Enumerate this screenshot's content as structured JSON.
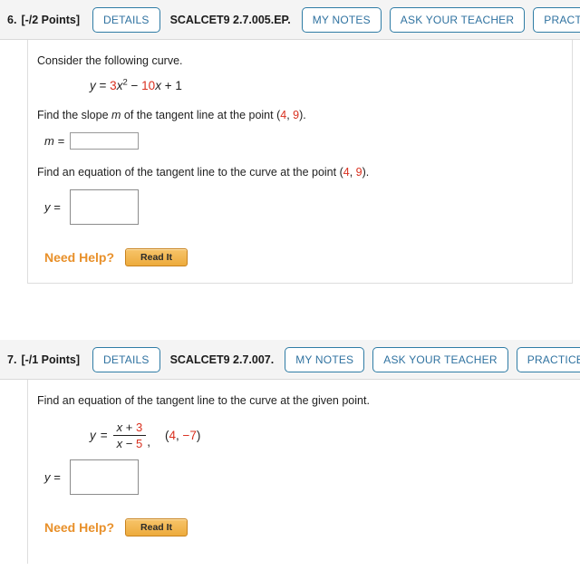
{
  "problems": [
    {
      "number": "6.",
      "points": "[-/2 Points]",
      "details_label": "DETAILS",
      "code": "SCALCET9 2.7.005.EP.",
      "my_notes_label": "MY NOTES",
      "ask_teacher_label": "ASK YOUR TEACHER",
      "practice_label": "PRACTICE",
      "prompt1": "Consider the following curve.",
      "equation": {
        "lhs": "y",
        "eq": "=",
        "coef1": "3",
        "var1": "x",
        "exp1": "2",
        "minus": "−",
        "coef2": "10",
        "var2": "x",
        "plus": "+",
        "const": "1"
      },
      "prompt2_a": "Find the slope ",
      "prompt2_m": "m",
      "prompt2_b": " of the tangent line at the point (",
      "prompt2_x": "4",
      "prompt2_sep": ", ",
      "prompt2_y": "9",
      "prompt2_c": ").",
      "answer1_label": "m =",
      "answer1_value": "",
      "prompt3_a": "Find an equation of the tangent line to the curve at the point (",
      "prompt3_x": "4",
      "prompt3_sep": ", ",
      "prompt3_y": "9",
      "prompt3_c": ").",
      "answer2_label": "y =",
      "answer2_value": "",
      "help_label": "Need Help?",
      "read_it_label": "Read It"
    },
    {
      "number": "7.",
      "points": "[-/1 Points]",
      "details_label": "DETAILS",
      "code": "SCALCET9 2.7.007.",
      "my_notes_label": "MY NOTES",
      "ask_teacher_label": "ASK YOUR TEACHER",
      "practice_label": "PRACTICE",
      "prompt1": "Find an equation of the tangent line to the curve at the given point.",
      "equation": {
        "lhs": "y",
        "eq": "=",
        "num_var": "x",
        "num_op": "+",
        "num_const": "3",
        "den_var": "x",
        "den_op": "−",
        "den_const": "5",
        "comma": ",",
        "point_open": "(",
        "point_x": "4",
        "point_sep": ", ",
        "point_y": "−7",
        "point_close": ")"
      },
      "answer_label": "y =",
      "answer_value": "",
      "help_label": "Need Help?",
      "read_it_label": "Read It"
    }
  ],
  "colors": {
    "accent_blue": "#2f72a0",
    "red_value": "#d9301f",
    "orange_help": "#e8902a",
    "header_bg": "#f4f4f4"
  }
}
